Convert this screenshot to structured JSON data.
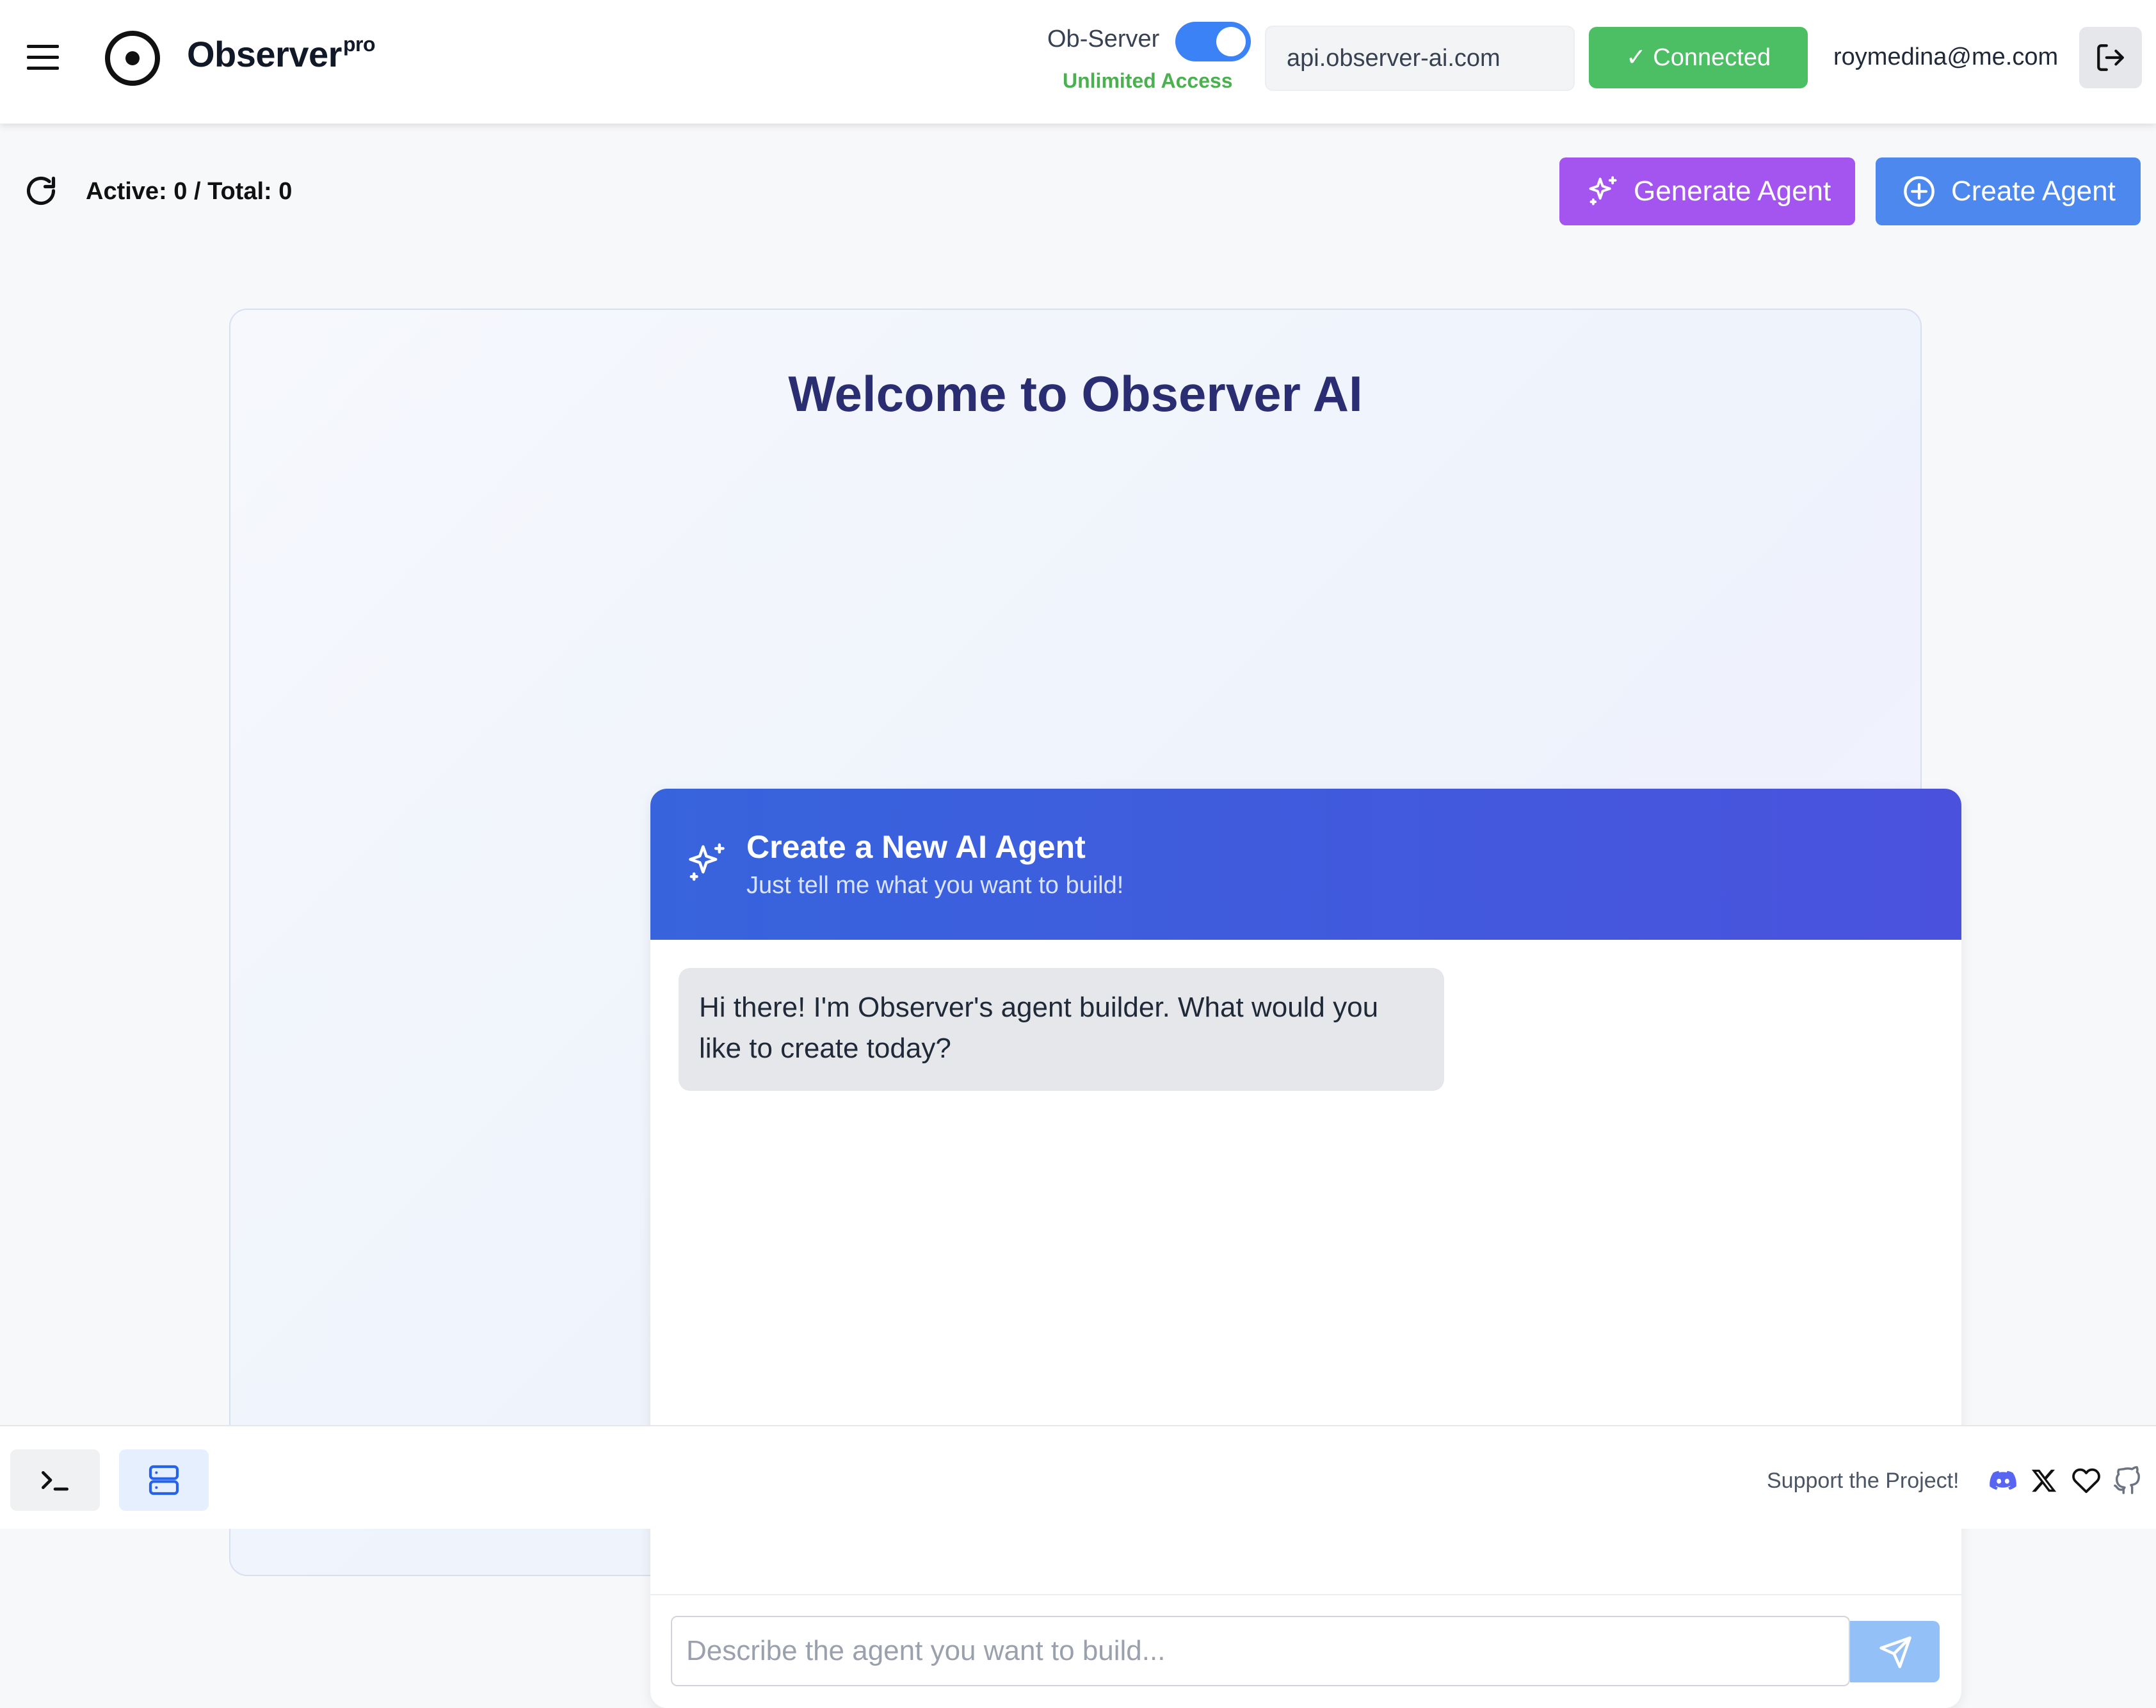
{
  "header": {
    "brand": "Observer",
    "brand_sup": "pro",
    "ob_server_label": "Ob-Server",
    "ob_server_enabled": true,
    "access_label": "Unlimited Access",
    "server_address": "api.observer-ai.com",
    "status_label": "✓ Connected",
    "user_email": "roymedina@me.com",
    "icons": [
      "menu-icon",
      "observer-logo-icon",
      "logout-icon"
    ],
    "accent_color": "#3b82f6",
    "status_color": "#4cbe63"
  },
  "toolbar": {
    "counts_label": "Active: 0 / Total: 0",
    "generate_label": "Generate Agent",
    "create_label": "Create Agent",
    "generate_color": "#a455ef",
    "create_color": "#4d88ee"
  },
  "main": {
    "welcome_title": "Welcome to Observer AI",
    "chat": {
      "title": "Create a New AI Agent",
      "subtitle": "Just tell me what you want to build!",
      "messages": [
        {
          "role": "assistant",
          "text": "Hi there! I'm Observer's agent builder. What would you like to create today?"
        }
      ],
      "input_placeholder": "Describe the agent you want to build..."
    }
  },
  "footer": {
    "support_label": "Support the Project!",
    "icons": [
      "terminal-icon",
      "server-icon",
      "discord-icon",
      "x-icon",
      "heart-icon",
      "github-icon"
    ]
  }
}
